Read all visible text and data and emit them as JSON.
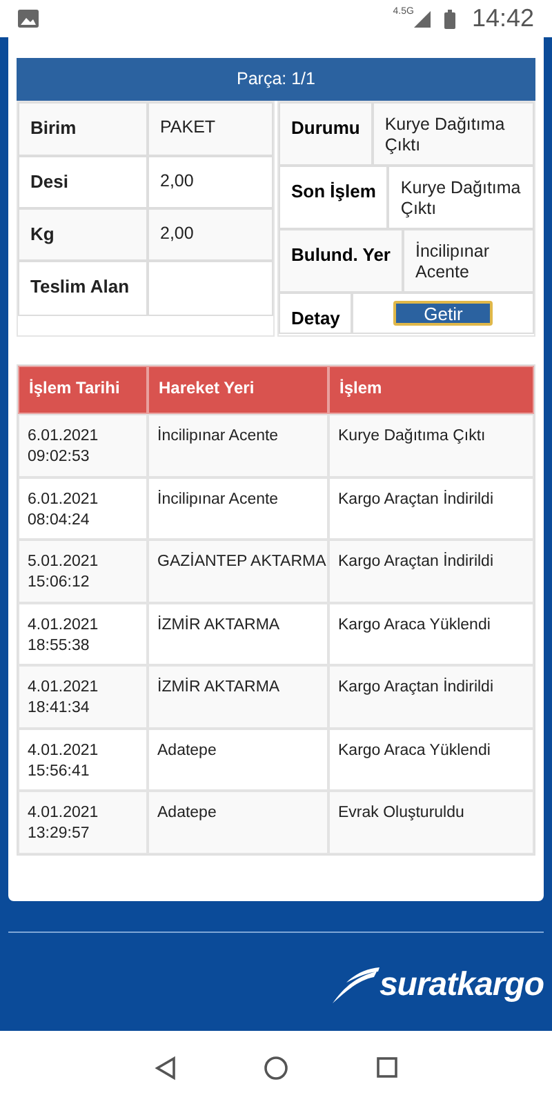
{
  "status_bar": {
    "network": "4.5G",
    "time": "14:42"
  },
  "part": {
    "title": "Parça: 1/1",
    "left_details": [
      {
        "label": "Birim",
        "value": "PAKET"
      },
      {
        "label": "Desi",
        "value": "2,00"
      },
      {
        "label": "Kg",
        "value": "2,00"
      },
      {
        "label": "Teslim Alan"
      }
    ],
    "right_details": [
      {
        "label": "Durumu",
        "kind": "text",
        "value": "Kurye Dağıtıma Çıktı"
      },
      {
        "label": "Son İşlem",
        "kind": "text",
        "value": "Kurye Dağıtıma Çıktı"
      },
      {
        "label": "Bulund. Yer",
        "kind": "text",
        "value": "İncilipınar Acente"
      },
      {
        "label": "Detay",
        "kind": "button",
        "value": "Getir"
      }
    ]
  },
  "movements": {
    "columns": [
      "İşlem Tarihi",
      "Hareket Yeri",
      "İşlem"
    ],
    "rows": [
      [
        "6.01.2021 09:02:53",
        "İncilipınar Acente",
        "Kurye Dağıtıma Çıktı"
      ],
      [
        "6.01.2021 08:04:24",
        "İncilipınar Acente",
        "Kargo Araçtan İndirildi"
      ],
      [
        "5.01.2021 15:06:12",
        "GAZİANTEP AKTARMA",
        "Kargo Araçtan İndirildi"
      ],
      [
        "4.01.2021 18:55:38",
        "İZMİR AKTARMA",
        "Kargo Araca Yüklendi"
      ],
      [
        "4.01.2021 18:41:34",
        "İZMİR AKTARMA",
        "Kargo Araçtan İndirildi"
      ],
      [
        "4.01.2021 15:56:41",
        "Adatepe",
        "Kargo Araca Yüklendi"
      ],
      [
        "4.01.2021 13:29:57",
        "Adatepe",
        "Evrak Oluşturuldu"
      ]
    ]
  },
  "footer": {
    "logo": "suratkargo"
  }
}
